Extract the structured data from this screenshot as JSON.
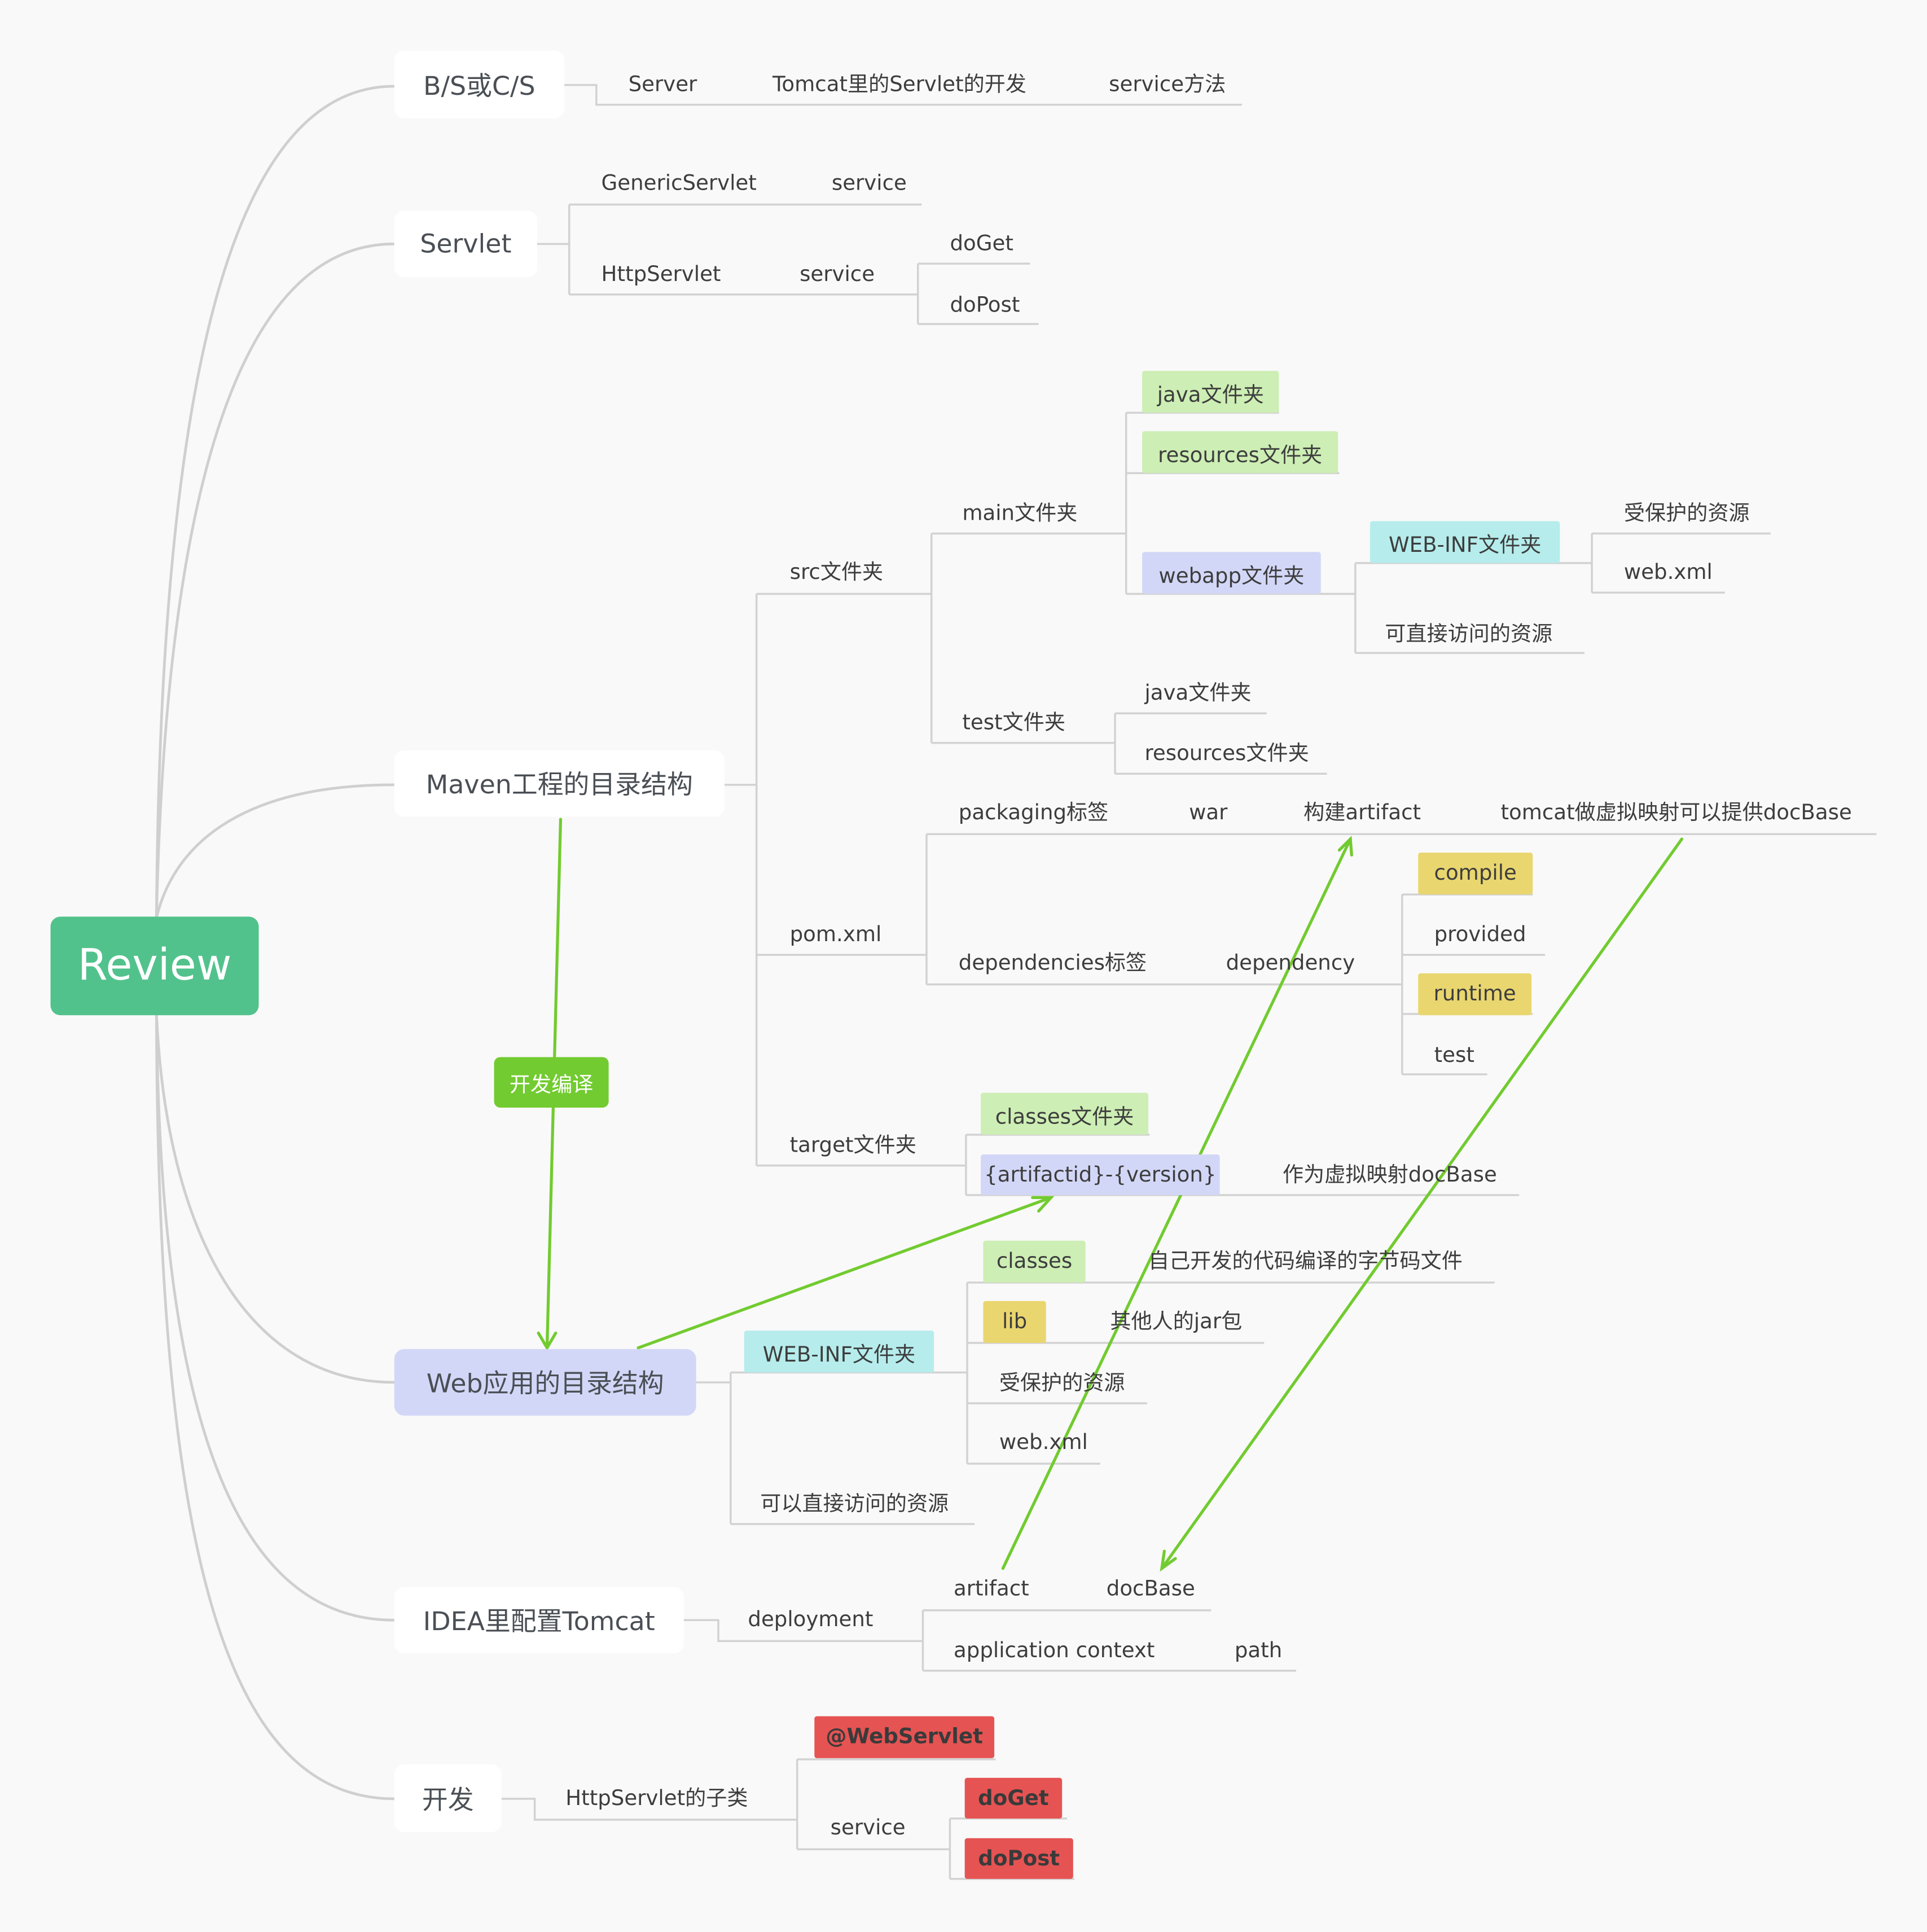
{
  "root": {
    "label": "Review",
    "color": "#52c28c"
  },
  "branches": {
    "bs": {
      "label": "B/S或C/S",
      "children": [
        "Server",
        "Tomcat里的Servlet的开发",
        "service方法"
      ]
    },
    "servlet": {
      "label": "Servlet",
      "generic": {
        "label": "GenericServlet",
        "child": "service"
      },
      "http": {
        "label": "HttpServlet",
        "child": "service",
        "methods": [
          "doGet",
          "doPost"
        ]
      }
    },
    "maven": {
      "label": "Maven工程的目录结构",
      "src": {
        "label": "src文件夹",
        "main": {
          "label": "main文件夹",
          "java": "java文件夹",
          "resources": "resources文件夹",
          "webapp": {
            "label": "webapp文件夹",
            "webinf": {
              "label": "WEB-INF文件夹",
              "children": [
                "受保护的资源",
                "web.xml"
              ]
            },
            "public": "可直接访问的资源"
          }
        },
        "test": {
          "label": "test文件夹",
          "children": [
            "java文件夹",
            "resources文件夹"
          ]
        }
      },
      "pom": {
        "label": "pom.xml",
        "packaging": {
          "label": "packaging标签",
          "value": "war",
          "build": "构建artifact",
          "note": "tomcat做虚拟映射可以提供docBase"
        },
        "dependencies": {
          "label": "dependencies标签",
          "child": "dependency",
          "scopes": [
            "compile",
            "provided",
            "runtime",
            "test"
          ]
        }
      },
      "target": {
        "label": "target文件夹",
        "classes": "classes文件夹",
        "artifact": "{artifactid}-{version}",
        "artifact_note": "作为虚拟映射docBase"
      }
    },
    "web": {
      "label": "Web应用的目录结构",
      "webinf": {
        "label": "WEB-INF文件夹",
        "classes": {
          "label": "classes",
          "note": "自己开发的代码编译的字节码文件"
        },
        "lib": {
          "label": "lib",
          "note": "其他人的jar包"
        },
        "protected": "受保护的资源",
        "webxml": "web.xml"
      },
      "public": "可以直接访问的资源"
    },
    "idea": {
      "label": "IDEA里配置Tomcat",
      "deployment": {
        "label": "deployment",
        "artifact": {
          "label": "artifact",
          "child": "docBase"
        },
        "context": {
          "label": "application context",
          "child": "path"
        }
      }
    },
    "dev": {
      "label": "开发",
      "subclass": {
        "label": "HttpServlet的子类",
        "annotation": "@WebServlet",
        "service": {
          "label": "service",
          "methods": [
            "doGet",
            "doPost"
          ]
        }
      }
    }
  },
  "relations": {
    "compile_label": "开发编译"
  },
  "colors": {
    "tag_green": "#cdeeb4",
    "tag_purple": "#d3d7f7",
    "tag_cyan": "#b6ecec",
    "tag_yellow": "#e9d66f",
    "tag_red": "#e65353",
    "relation_green": "#72cb30"
  }
}
